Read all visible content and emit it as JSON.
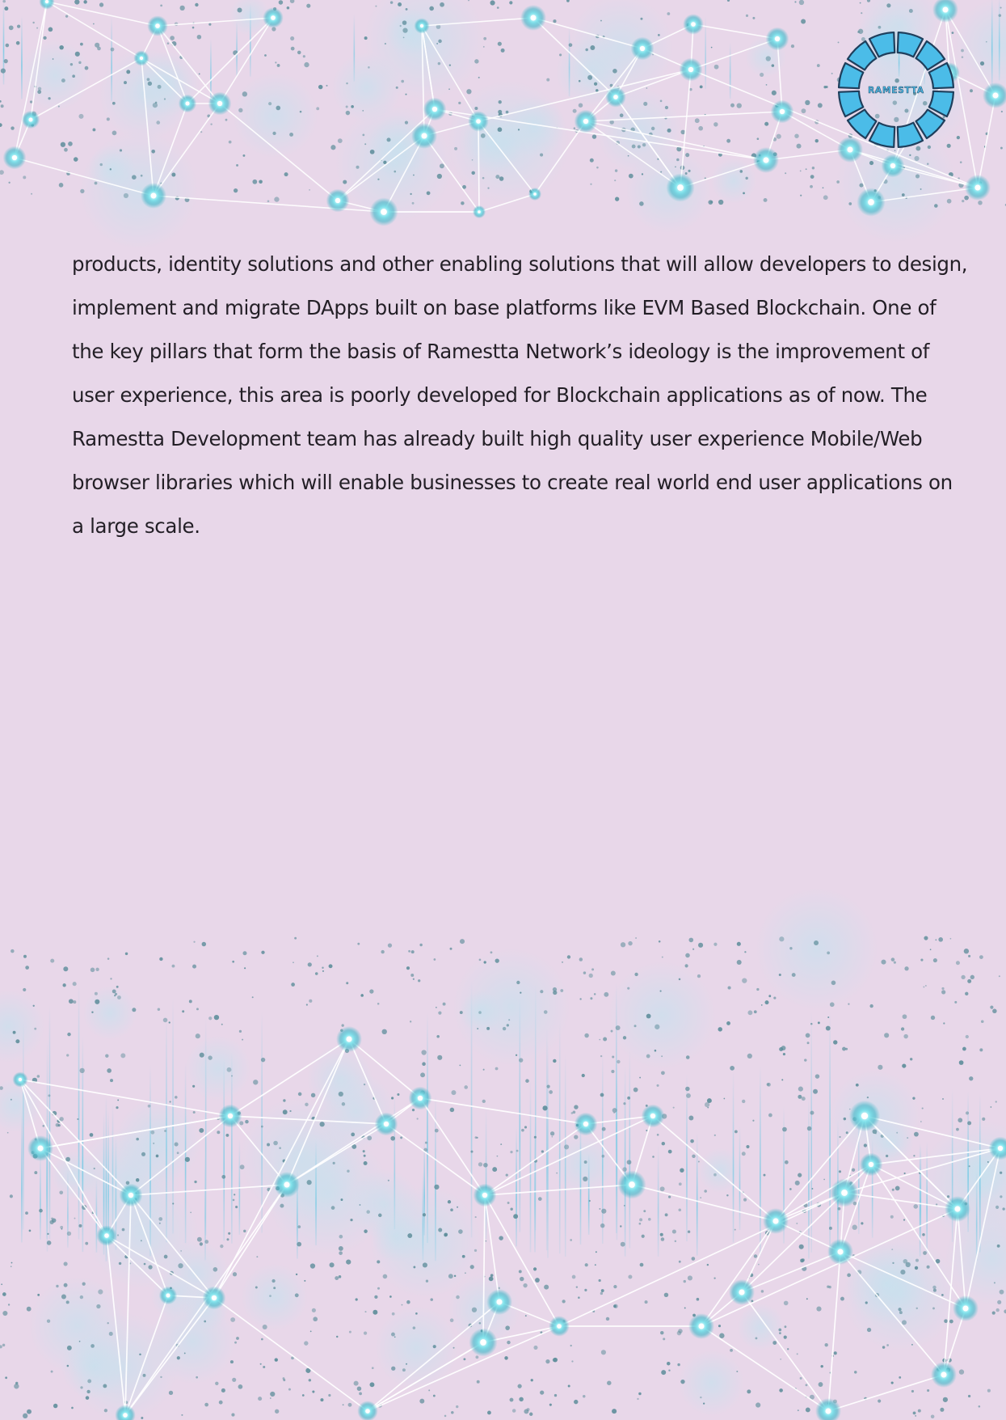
{
  "document": {
    "logo_text": "RAMESTTA",
    "paragraph_lines": [
      "products, identity solutions and other enabling solutions that will allow developers to design,",
      "implement and migrate DApps built on base platforms like EVM Based Blockchain. One of",
      "the key pillars that form the basis of Ramestta Network’s ideology is the improvement of",
      "user experience, this area is poorly developed for Blockchain applications as of now. The",
      "Ramestta Development team has already built high quality user experience Mobile/Web",
      "browser libraries which will enable businesses to create real world end user applications on",
      "a large scale."
    ]
  },
  "colors": {
    "background": "#e8d7e9",
    "text": "#231f26",
    "logo_fill": "#4bbce8",
    "logo_outline": "#1f3f5c",
    "network_line": "#ffffff",
    "node_glow": "#2fb3c4",
    "dot": "#5b8c99"
  },
  "icons": {
    "logo": "ramestta-segmented-ring-logo",
    "decoration_top": "network-mesh-icon",
    "decoration_bottom": "network-mesh-icon"
  }
}
